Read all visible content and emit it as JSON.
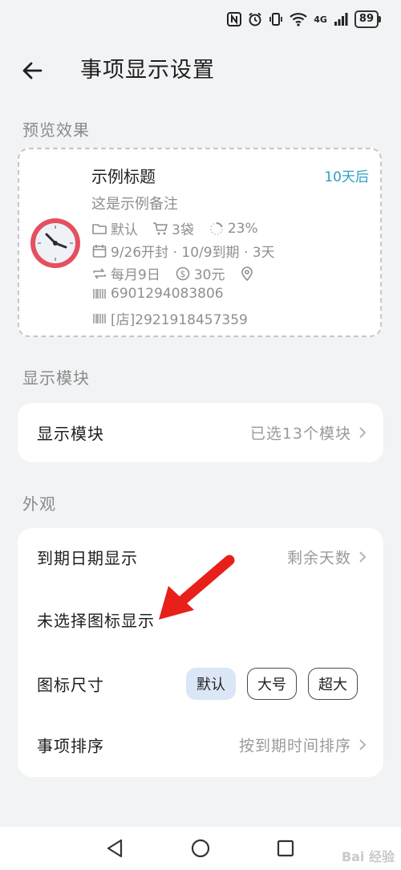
{
  "status_bar": {
    "battery": "89",
    "network": "4G",
    "icons": [
      "nfc-icon",
      "alarm-icon",
      "vibrate-icon",
      "wifi-icon",
      "signal-icon",
      "battery-icon"
    ]
  },
  "header": {
    "title": "事项显示设置",
    "back_icon": "arrow-left-icon"
  },
  "preview": {
    "section_label": "预览效果",
    "title": "示例标题",
    "days_left": "10天后",
    "note": "这是示例备注",
    "folder": "默认",
    "quantity": "3袋",
    "progress": "23%",
    "dates": "9/26开封 · 10/9到期 · 3天",
    "repeat": "每月9日",
    "price": "30元",
    "barcode": "6901294083806",
    "store_barcode": "[店]2921918457359",
    "accent_color": "#2aa0c8"
  },
  "modules": {
    "section_label": "显示模块",
    "row_label": "显示模块",
    "row_value": "已选13个模块"
  },
  "appearance": {
    "section_label": "外观",
    "expiry_label": "到期日期显示",
    "expiry_value": "剩余天数",
    "no_icon_label": "未选择图标显示",
    "icon_size_label": "图标尺寸",
    "icon_size_options": [
      "默认",
      "大号",
      "超大"
    ],
    "icon_size_selected": "默认",
    "sort_label": "事项排序",
    "sort_value": "按到期时间排序"
  },
  "watermark": "Bai 经验"
}
